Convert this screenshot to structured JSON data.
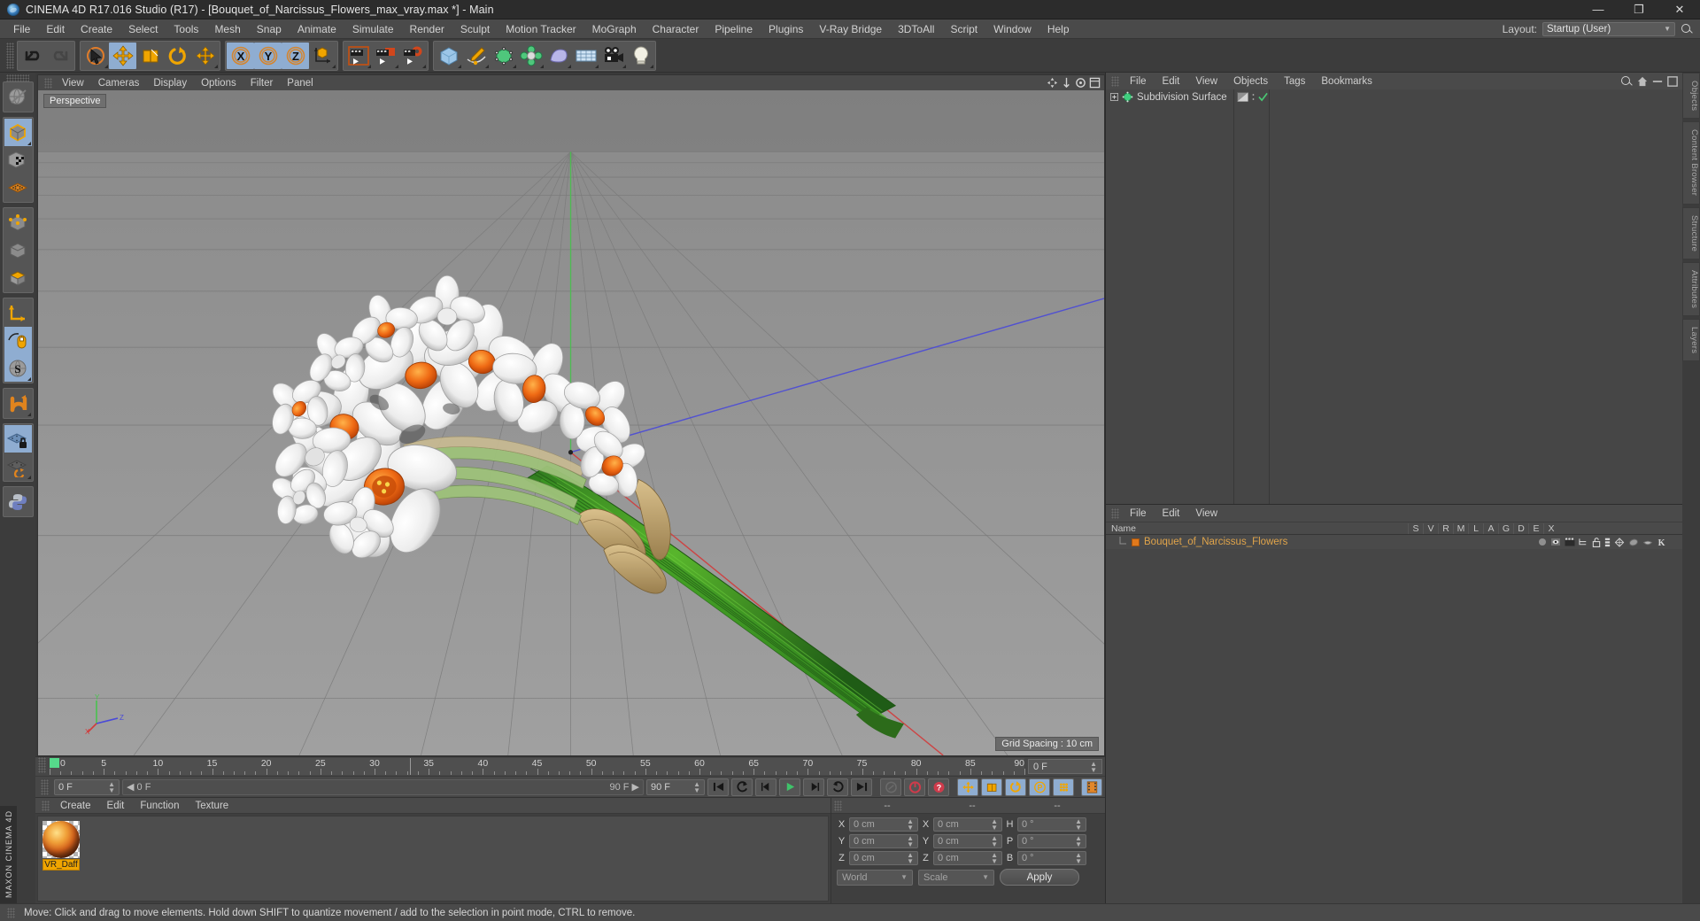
{
  "window": {
    "title": "CINEMA 4D R17.016 Studio (R17) - [Bouquet_of_Narcissus_Flowers_max_vray.max *] - Main",
    "minimize": "—",
    "maximize": "❐",
    "close": "✕"
  },
  "menubar": {
    "items": [
      "File",
      "Edit",
      "Create",
      "Select",
      "Tools",
      "Mesh",
      "Snap",
      "Animate",
      "Simulate",
      "Render",
      "Sculpt",
      "Motion Tracker",
      "MoGraph",
      "Character",
      "Pipeline",
      "Plugins",
      "V-Ray Bridge",
      "3DToAll",
      "Script",
      "Window",
      "Help"
    ],
    "layout_label": "Layout:",
    "layout_value": "Startup (User)",
    "layout_arrow": "▼"
  },
  "viewport": {
    "menu": [
      "View",
      "Cameras",
      "Display",
      "Options",
      "Filter",
      "Panel"
    ],
    "label": "Perspective",
    "grid_spacing": "Grid Spacing : 10 cm",
    "axis_x": "X",
    "axis_y": "Y",
    "axis_z": "Z"
  },
  "timeline": {
    "ticks": [
      0,
      5,
      10,
      15,
      20,
      25,
      30,
      35,
      40,
      45,
      50,
      55,
      60,
      65,
      70,
      75,
      80,
      85,
      90
    ],
    "current_frame": "0 F",
    "end_frame": "90 F",
    "range_start": "0 F",
    "range_end": "90 F",
    "preview_end": "90 F"
  },
  "material_manager": {
    "menu": [
      "Create",
      "Edit",
      "Function",
      "Texture"
    ],
    "materials": [
      {
        "name": "VR_Daff"
      }
    ]
  },
  "coordinates": {
    "headers": [
      "--",
      "--",
      "--"
    ],
    "rows": [
      {
        "axis1": "X",
        "v1": "0 cm",
        "axis2": "X",
        "v2": "0 cm",
        "axis3": "H",
        "v3": "0 °"
      },
      {
        "axis1": "Y",
        "v1": "0 cm",
        "axis2": "Y",
        "v2": "0 cm",
        "axis3": "P",
        "v3": "0 °"
      },
      {
        "axis1": "Z",
        "v1": "0 cm",
        "axis2": "Z",
        "v2": "0 cm",
        "axis3": "B",
        "v3": "0 °"
      }
    ],
    "system": "World",
    "mode": "Scale",
    "apply": "Apply",
    "arrow": "▼"
  },
  "object_manager": {
    "menu": [
      "File",
      "Edit",
      "View",
      "Objects",
      "Tags",
      "Bookmarks"
    ],
    "item": "Subdivision Surface",
    "check": "✓"
  },
  "attribute_manager": {
    "menu": [
      "File",
      "Edit",
      "View"
    ],
    "columns": [
      "Name",
      "S",
      "V",
      "R",
      "M",
      "L",
      "A",
      "G",
      "D",
      "E",
      "X"
    ],
    "rows": [
      {
        "name": "Bouquet_of_Narcissus_Flowers"
      }
    ]
  },
  "right_tabs": [
    "Objects",
    "Content Browser",
    "Structure",
    "Attributes",
    "Layers"
  ],
  "status": {
    "message": "Move: Click and drag to move elements. Hold down SHIFT to quantize movement / add to the selection in point mode, CTRL to remove."
  },
  "brand": {
    "text": "MAXON CINEMA 4D"
  },
  "toolbar": {
    "groups": [
      {
        "buttons": [
          {
            "name": "undo-icon",
            "selected": false
          },
          {
            "name": "redo-icon",
            "selected": false
          }
        ]
      },
      {
        "buttons": [
          {
            "name": "live-selection-icon",
            "selected": false
          },
          {
            "name": "move-tool-icon",
            "selected": true
          },
          {
            "name": "scale-tool-icon",
            "selected": false
          },
          {
            "name": "rotate-tool-icon",
            "selected": false
          },
          {
            "name": "move-alt-icon",
            "selected": false
          }
        ]
      },
      {
        "buttons": [
          {
            "name": "axis-x-icon",
            "selected": true
          },
          {
            "name": "axis-y-icon",
            "selected": true
          },
          {
            "name": "axis-z-icon",
            "selected": true
          },
          {
            "name": "world-axis-icon",
            "selected": false
          }
        ]
      },
      {
        "buttons": [
          {
            "name": "render-view-icon",
            "selected": false
          },
          {
            "name": "render-picture-viewer-icon",
            "selected": false
          },
          {
            "name": "render-settings-icon",
            "selected": false
          }
        ]
      },
      {
        "buttons": [
          {
            "name": "cube-primitive-icon",
            "selected": false
          },
          {
            "name": "spline-pen-icon",
            "selected": false
          },
          {
            "name": "nurbs-generator-icon",
            "selected": false
          },
          {
            "name": "array-deformer-icon",
            "selected": false
          },
          {
            "name": "bend-deformer-icon",
            "selected": false
          },
          {
            "name": "floor-environment-icon",
            "selected": false
          },
          {
            "name": "camera-icon",
            "selected": false
          },
          {
            "name": "light-icon",
            "selected": false
          }
        ]
      }
    ]
  },
  "left_toolbar": {
    "buttons": [
      {
        "name": "make-editable-icon",
        "selected": false
      },
      {
        "name": "model-mode-icon",
        "selected": true
      },
      {
        "name": "texture-mode-icon",
        "selected": false
      },
      {
        "name": "points-mode-icon",
        "selected": false
      },
      {
        "name": "edge-mode-icon",
        "selected": false
      },
      {
        "name": "polygon-mode-icon",
        "selected": false
      },
      {
        "name": "object-axis-icon",
        "selected": false
      },
      {
        "name": "viewport-solo-icon",
        "selected": true
      },
      {
        "name": "enable-snap-icon",
        "selected": true
      },
      {
        "name": "magnet-icon",
        "selected": false
      },
      {
        "name": "workplane-lock-icon",
        "selected": true
      },
      {
        "name": "workplane-rotate-icon",
        "selected": false
      },
      {
        "name": "python-icon",
        "selected": false
      }
    ]
  }
}
